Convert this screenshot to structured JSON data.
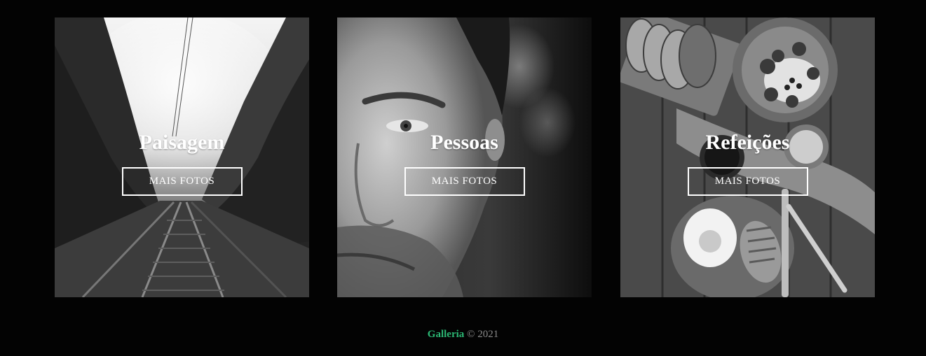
{
  "gallery": {
    "cards": [
      {
        "title": "Paisagem",
        "button_label": "MAIS FOTOS",
        "image": "railway-track-forest-photo"
      },
      {
        "title": "Pessoas",
        "button_label": "MAIS FOTOS",
        "image": "man-face-portrait-photo"
      },
      {
        "title": "Refeições",
        "button_label": "MAIS FOTOS",
        "image": "breakfast-table-photo"
      }
    ]
  },
  "footer": {
    "brand": "Galleria",
    "copyright": "© 2021"
  },
  "colors": {
    "background": "#030303",
    "brand_accent": "#2bb673",
    "footer_text": "#8a8a8a",
    "button_border": "#ffffff"
  }
}
